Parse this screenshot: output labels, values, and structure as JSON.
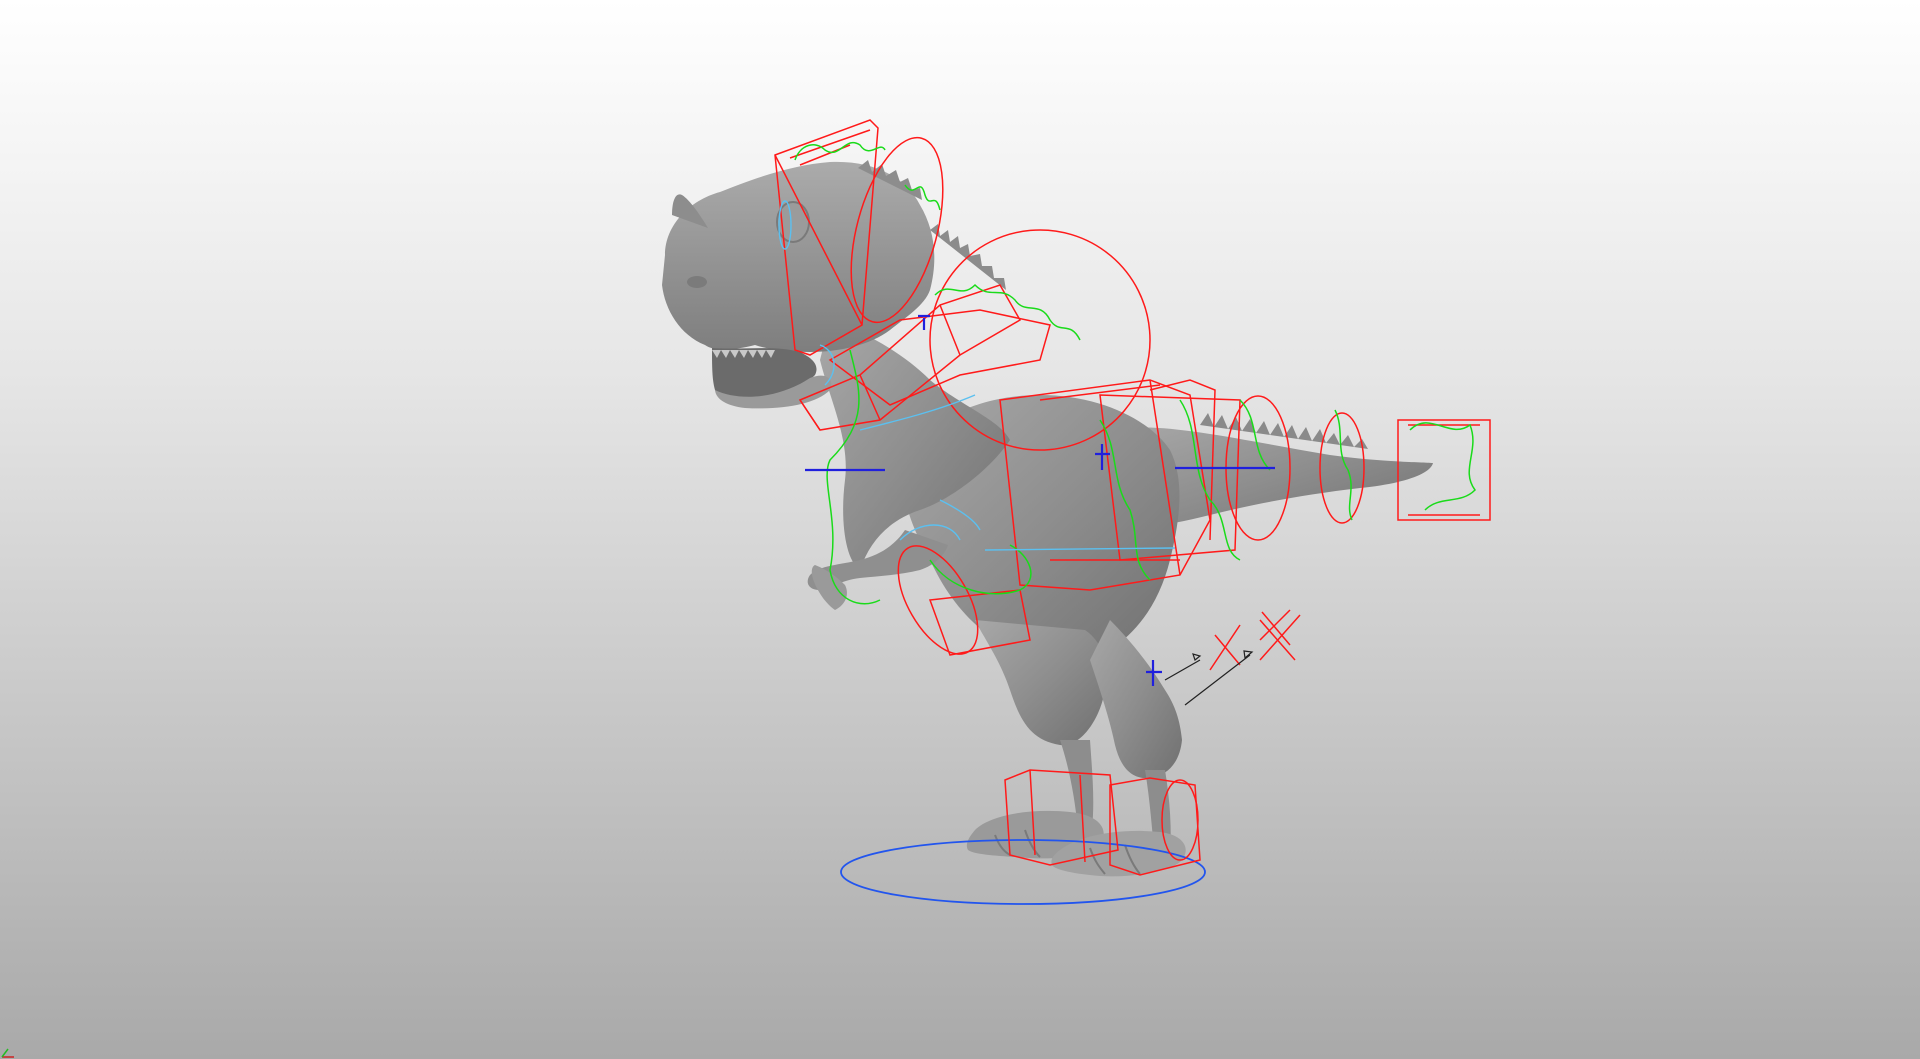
{
  "viewport": {
    "background_top": "#ffffff",
    "background_bottom": "#a9a9a9"
  },
  "model": {
    "fill": "#8e8e8e",
    "fill_light": "#a3a3a3",
    "fill_dark": "#6f6f6f",
    "eye": "#9a9a9a"
  },
  "rig": {
    "fk_control_color": "#ff1a1a",
    "ik_curve_color": "#1adb1a",
    "spline_color": "#5bc0f0",
    "locator_color": "#2020dd",
    "root_control_color": "#2255ee",
    "pole_vector_color": "#222222"
  },
  "gizmo": {
    "x_color": "#cc2222",
    "y_color": "#22bb22"
  }
}
